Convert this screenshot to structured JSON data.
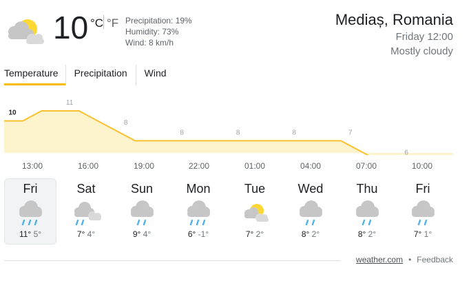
{
  "current": {
    "temperature": "10",
    "unit_c": "°C",
    "unit_f": "°F",
    "precipitation": "Precipitation: 19%",
    "humidity": "Humidity: 73%",
    "wind": "Wind: 8 km/h",
    "icon": "partly-cloudy-icon"
  },
  "location": {
    "city": "Mediaș, Romania",
    "time": "Friday 12:00",
    "condition": "Mostly cloudy"
  },
  "tabs": [
    {
      "label": "Temperature",
      "active": true
    },
    {
      "label": "Precipitation",
      "active": false
    },
    {
      "label": "Wind",
      "active": false
    }
  ],
  "chart_data": {
    "type": "area",
    "x": [
      "12:00",
      "13:00",
      "14:00",
      "15:00",
      "16:00",
      "17:00",
      "18:00",
      "19:00",
      "20:00",
      "21:00",
      "22:00",
      "23:00",
      "00:00",
      "01:00",
      "02:00",
      "03:00",
      "04:00",
      "05:00",
      "06:00",
      "07:00",
      "08:00",
      "09:00",
      "10:00",
      "11:00"
    ],
    "values": [
      10,
      10,
      11,
      11,
      11,
      10,
      9,
      8,
      8,
      8,
      8,
      8,
      8,
      8,
      8,
      8,
      8,
      8,
      8,
      7,
      6,
      6,
      6,
      6
    ],
    "labels": [
      {
        "index": 0,
        "text": "10"
      },
      {
        "index": 3,
        "text": "11"
      },
      {
        "index": 6,
        "text": "8"
      },
      {
        "index": 9,
        "text": "8"
      },
      {
        "index": 12,
        "text": "8"
      },
      {
        "index": 15,
        "text": "8"
      },
      {
        "index": 18,
        "text": "7"
      },
      {
        "index": 21,
        "text": "6"
      }
    ],
    "x_ticks": [
      "13:00",
      "16:00",
      "19:00",
      "22:00",
      "01:00",
      "04:00",
      "07:00",
      "10:00"
    ],
    "colors": {
      "line": "#fbc02d",
      "fill": "#fdf3cc"
    }
  },
  "days": [
    {
      "name": "Fri",
      "high": "11°",
      "low": "5°",
      "icon": "rain-icon",
      "selected": true
    },
    {
      "name": "Sat",
      "high": "7°",
      "low": "4°",
      "icon": "cloudy-rain-icon",
      "selected": false
    },
    {
      "name": "Sun",
      "high": "9°",
      "low": "4°",
      "icon": "showers-icon",
      "selected": false
    },
    {
      "name": "Mon",
      "high": "6°",
      "low": "-1°",
      "icon": "rain-icon",
      "selected": false
    },
    {
      "name": "Tue",
      "high": "7°",
      "low": "2°",
      "icon": "partly-cloudy-icon",
      "selected": false
    },
    {
      "name": "Wed",
      "high": "8°",
      "low": "2°",
      "icon": "showers-icon",
      "selected": false
    },
    {
      "name": "Thu",
      "high": "8°",
      "low": "2°",
      "icon": "showers-icon",
      "selected": false
    },
    {
      "name": "Fri",
      "high": "7°",
      "low": "1°",
      "icon": "showers-icon",
      "selected": false
    }
  ],
  "footer": {
    "source": "weather.com",
    "separator": "•",
    "feedback": "Feedback"
  }
}
